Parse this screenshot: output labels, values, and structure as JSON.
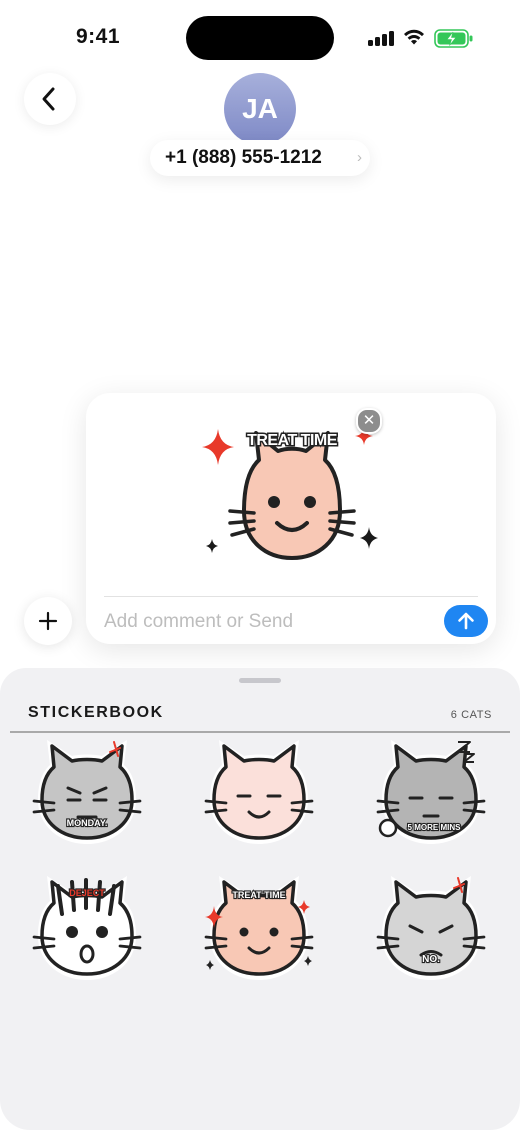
{
  "status_bar": {
    "time": "9:41"
  },
  "contact": {
    "initials": "JA",
    "name": "+1 (888) 555-1212",
    "chevron": "›"
  },
  "compose": {
    "sticker": {
      "caption": "TREAT TIME",
      "face_color": "#f8c8b5"
    },
    "remove_glyph": "✕",
    "input_placeholder": "Add comment or Send",
    "input_value": ""
  },
  "sticker_sheet": {
    "title": "STICKERBOOK",
    "count": "6 CATS",
    "stickers": [
      {
        "caption": "MONDAY.",
        "face_color": "#c5c5c5",
        "expression": "grumpy"
      },
      {
        "caption": "",
        "face_color": "#fbe0da",
        "expression": "content"
      },
      {
        "caption": "5 MORE MINS",
        "face_color": "#b4b4b4",
        "expression": "sleepy"
      },
      {
        "caption": "DEJECT",
        "face_color": "#ffffff",
        "expression": "shocked"
      },
      {
        "caption": "TREAT TIME",
        "face_color": "#f8c8b5",
        "expression": "happy"
      },
      {
        "caption": "NO.",
        "face_color": "#d5d5d5",
        "expression": "annoyed"
      }
    ]
  },
  "colors": {
    "accent_send": "#1f86f2",
    "sparkle_red": "#e8392a",
    "avatar_gradient": [
      "#a7b0db",
      "#7e89c6"
    ],
    "battery_green": "#34c759"
  },
  "icons": {
    "back": "chevron-left-icon",
    "add": "plus-icon",
    "send": "arrow-up-icon",
    "remove": "close-icon"
  }
}
